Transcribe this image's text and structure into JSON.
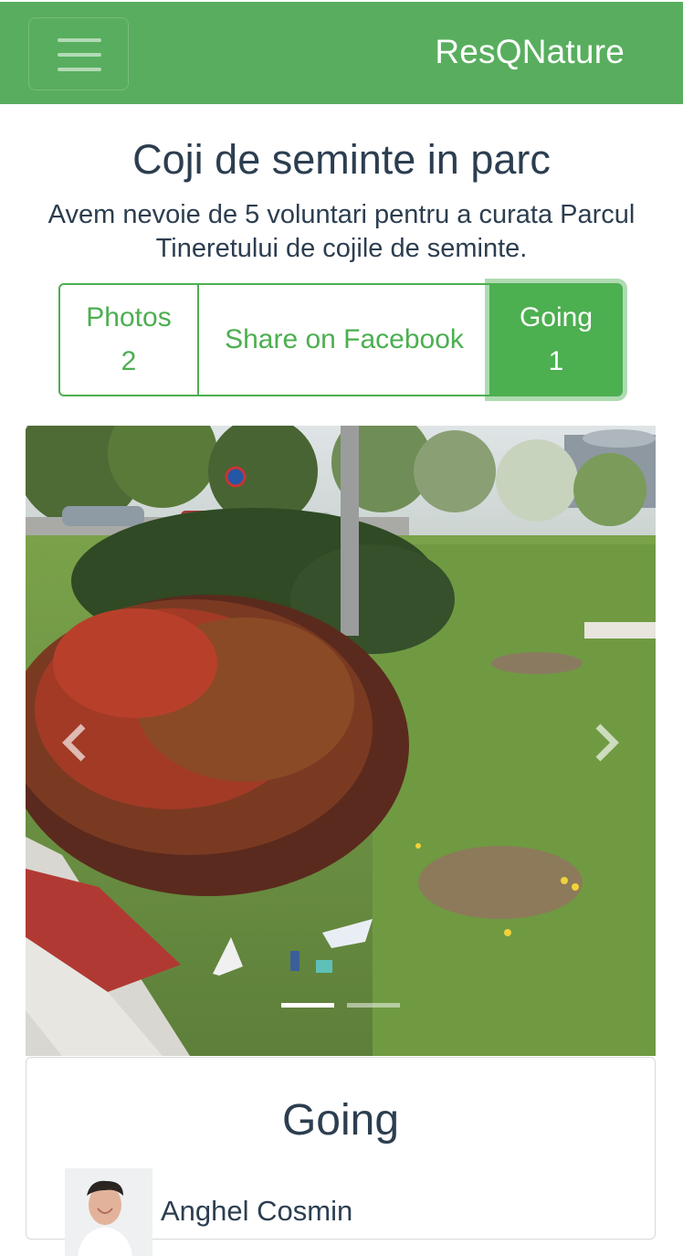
{
  "navbar": {
    "brand": "ResQNature",
    "menu_icon": "hamburger-menu-icon",
    "color": "#58ae5e"
  },
  "event": {
    "title": "Coji de seminte in parc",
    "description": "Avem nevoie de 5 voluntari pentru a curata Parcul Tineretului de cojile de seminte."
  },
  "actions": {
    "photos_label": "Photos",
    "photos_count": "2",
    "share_label": "Share on Facebook",
    "going_label": "Going",
    "going_count": "1",
    "accent": "#4caf50"
  },
  "carousel": {
    "prev_icon": "chevron-left-icon",
    "next_icon": "chevron-right-icon",
    "slide_count": 2,
    "active_slide": 1
  },
  "going_section": {
    "title": "Going",
    "people": [
      {
        "name": "Anghel Cosmin"
      }
    ]
  }
}
